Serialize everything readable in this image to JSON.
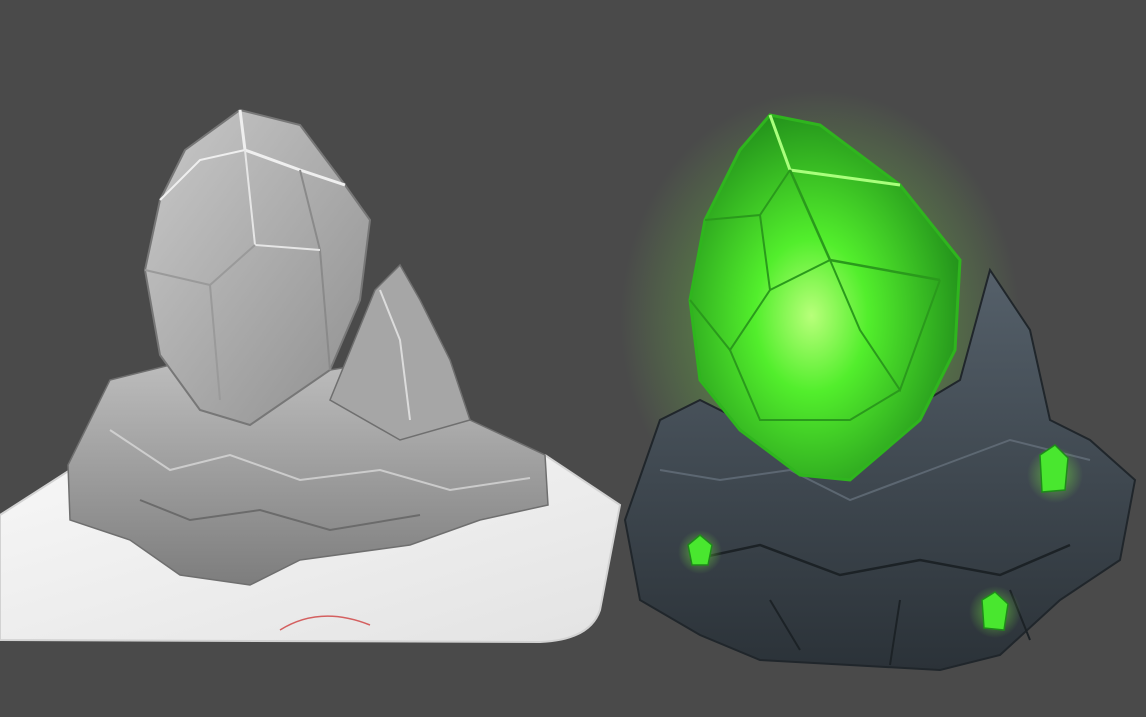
{
  "scene": {
    "background_color": "#4a4a4a",
    "left_model": {
      "description_key": "untextured-sculpt",
      "base_color": "#f0f0f0",
      "rock_color": "#a9a9a9",
      "crystal_color": "#b2b2b2"
    },
    "right_model": {
      "description_key": "textured-render",
      "rock_color": "#3c4650",
      "crystal_color": "#3ee62a",
      "glow_color": "#6dff3a"
    }
  }
}
